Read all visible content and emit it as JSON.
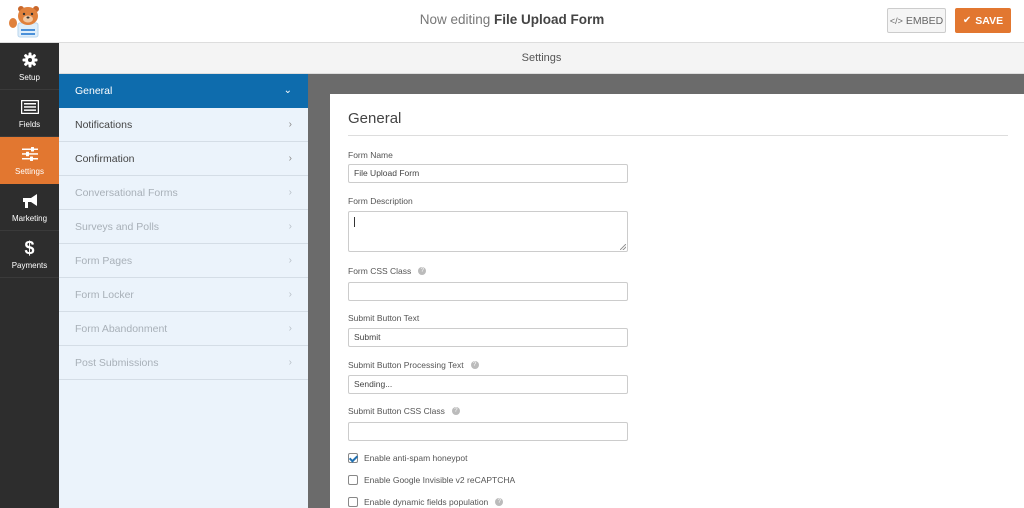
{
  "header": {
    "title_prefix": "Now editing",
    "form_name": "File Upload Form",
    "embed_label": "EMBED",
    "embed_icon": "</>",
    "save_label": "SAVE",
    "save_icon": "✔"
  },
  "leftnav": {
    "items": [
      {
        "label": "Setup",
        "icon": "gear-icon"
      },
      {
        "label": "Fields",
        "icon": "fields-icon"
      },
      {
        "label": "Settings",
        "icon": "sliders-icon",
        "active": true
      },
      {
        "label": "Marketing",
        "icon": "megaphone-icon"
      },
      {
        "label": "Payments",
        "icon": "dollar-icon"
      }
    ]
  },
  "settings_bar": {
    "title": "Settings"
  },
  "subnav": {
    "items": [
      {
        "label": "General",
        "state": "active",
        "chevron": "⌄"
      },
      {
        "label": "Notifications",
        "state": "normal",
        "chevron": "›"
      },
      {
        "label": "Confirmation",
        "state": "normal",
        "chevron": "›"
      },
      {
        "label": "Conversational Forms",
        "state": "disabled",
        "chevron": "›"
      },
      {
        "label": "Surveys and Polls",
        "state": "disabled",
        "chevron": "›"
      },
      {
        "label": "Form Pages",
        "state": "disabled",
        "chevron": "›"
      },
      {
        "label": "Form Locker",
        "state": "disabled",
        "chevron": "›"
      },
      {
        "label": "Form Abandonment",
        "state": "disabled",
        "chevron": "›"
      },
      {
        "label": "Post Submissions",
        "state": "disabled",
        "chevron": "›"
      }
    ]
  },
  "panel": {
    "title": "General",
    "fields": {
      "form_name": {
        "label": "Form Name",
        "value": "File Upload Form"
      },
      "form_description": {
        "label": "Form Description",
        "value": ""
      },
      "form_css_class": {
        "label": "Form CSS Class",
        "value": ""
      },
      "submit_text": {
        "label": "Submit Button Text",
        "value": "Submit"
      },
      "submit_processing": {
        "label": "Submit Button Processing Text",
        "value": "Sending..."
      },
      "submit_css_class": {
        "label": "Submit Button CSS Class",
        "value": ""
      }
    },
    "checkboxes": [
      {
        "label": "Enable anti-spam honeypot",
        "checked": true
      },
      {
        "label": "Enable Google Invisible v2 reCAPTCHA",
        "checked": false
      },
      {
        "label": "Enable dynamic fields population",
        "checked": false
      }
    ],
    "help_glyph": "?"
  }
}
